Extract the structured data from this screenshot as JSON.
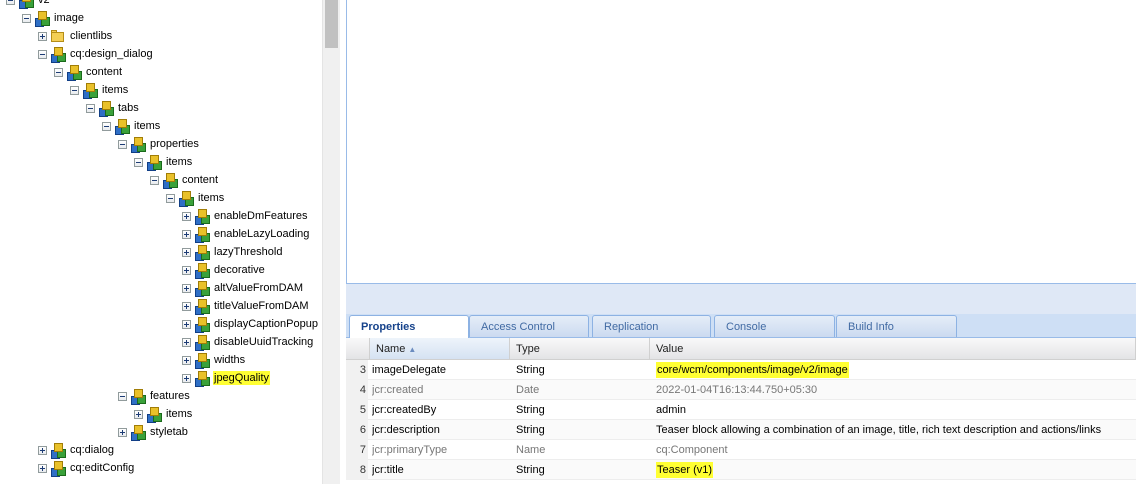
{
  "tree": {
    "nodes": [
      {
        "label": "v2",
        "toggle": "minus",
        "icon": "node",
        "indent": 0,
        "highlight": false
      },
      {
        "label": "image",
        "toggle": "minus",
        "icon": "node",
        "indent": 1,
        "highlight": false
      },
      {
        "label": "clientlibs",
        "toggle": "plus",
        "icon": "folder",
        "indent": 2,
        "highlight": false
      },
      {
        "label": "cq:design_dialog",
        "toggle": "minus",
        "icon": "node",
        "indent": 2,
        "highlight": false
      },
      {
        "label": "content",
        "toggle": "minus",
        "icon": "node",
        "indent": 3,
        "highlight": false
      },
      {
        "label": "items",
        "toggle": "minus",
        "icon": "node",
        "indent": 4,
        "highlight": false
      },
      {
        "label": "tabs",
        "toggle": "minus",
        "icon": "node",
        "indent": 5,
        "highlight": false
      },
      {
        "label": "items",
        "toggle": "minus",
        "icon": "node",
        "indent": 6,
        "highlight": false
      },
      {
        "label": "properties",
        "toggle": "minus",
        "icon": "node",
        "indent": 7,
        "highlight": false
      },
      {
        "label": "items",
        "toggle": "minus",
        "icon": "node",
        "indent": 8,
        "highlight": false
      },
      {
        "label": "content",
        "toggle": "minus",
        "icon": "node",
        "indent": 9,
        "highlight": false
      },
      {
        "label": "items",
        "toggle": "minus",
        "icon": "node",
        "indent": 10,
        "highlight": false
      },
      {
        "label": "enableDmFeatures",
        "toggle": "plus",
        "icon": "node",
        "indent": 11,
        "highlight": false
      },
      {
        "label": "enableLazyLoading",
        "toggle": "plus",
        "icon": "node",
        "indent": 11,
        "highlight": false
      },
      {
        "label": "lazyThreshold",
        "toggle": "plus",
        "icon": "node",
        "indent": 11,
        "highlight": false
      },
      {
        "label": "decorative",
        "toggle": "plus",
        "icon": "node",
        "indent": 11,
        "highlight": false
      },
      {
        "label": "altValueFromDAM",
        "toggle": "plus",
        "icon": "node",
        "indent": 11,
        "highlight": false
      },
      {
        "label": "titleValueFromDAM",
        "toggle": "plus",
        "icon": "node",
        "indent": 11,
        "highlight": false
      },
      {
        "label": "displayCaptionPopup",
        "toggle": "plus",
        "icon": "node",
        "indent": 11,
        "highlight": false
      },
      {
        "label": "disableUuidTracking",
        "toggle": "plus",
        "icon": "node",
        "indent": 11,
        "highlight": false
      },
      {
        "label": "widths",
        "toggle": "plus",
        "icon": "node",
        "indent": 11,
        "highlight": false
      },
      {
        "label": "jpegQuality",
        "toggle": "plus",
        "icon": "node",
        "indent": 11,
        "highlight": true
      },
      {
        "label": "features",
        "toggle": "minus",
        "icon": "node",
        "indent": 7,
        "highlight": false
      },
      {
        "label": "items",
        "toggle": "plus",
        "icon": "node",
        "indent": 8,
        "highlight": false
      },
      {
        "label": "styletab",
        "toggle": "plus",
        "icon": "node",
        "indent": 7,
        "highlight": false
      },
      {
        "label": "cq:dialog",
        "toggle": "plus",
        "icon": "node",
        "indent": 2,
        "highlight": false
      },
      {
        "label": "cq:editConfig",
        "toggle": "plus",
        "icon": "node",
        "indent": 2,
        "highlight": false
      }
    ]
  },
  "tabs": [
    {
      "label": "Properties",
      "active": true
    },
    {
      "label": "Access Control",
      "active": false
    },
    {
      "label": "Replication",
      "active": false
    },
    {
      "label": "Console",
      "active": false
    },
    {
      "label": "Build Info",
      "active": false
    }
  ],
  "grid": {
    "columns": {
      "name": "Name",
      "type": "Type",
      "value": "Value"
    },
    "sort_icon": "sort-ascending-icon",
    "rows": [
      {
        "num": "3",
        "name": "imageDelegate",
        "type": "String",
        "value": "core/wcm/components/image/v2/image",
        "protected": false,
        "highlight": true
      },
      {
        "num": "4",
        "name": "jcr:created",
        "type": "Date",
        "value": "2022-01-04T16:13:44.750+05:30",
        "protected": true,
        "highlight": false
      },
      {
        "num": "5",
        "name": "jcr:createdBy",
        "type": "String",
        "value": "admin",
        "protected": false,
        "highlight": false
      },
      {
        "num": "6",
        "name": "jcr:description",
        "type": "String",
        "value": "Teaser block allowing a combination of an image, title, rich text description and actions/links",
        "protected": false,
        "highlight": false
      },
      {
        "num": "7",
        "name": "jcr:primaryType",
        "type": "Name",
        "value": "cq:Component",
        "protected": true,
        "highlight": false
      },
      {
        "num": "8",
        "name": "jcr:title",
        "type": "String",
        "value": "Teaser (v1)",
        "protected": false,
        "highlight": true
      }
    ]
  },
  "colors": {
    "highlight": "#ffff33",
    "tab_text": "#416aa3",
    "active_tab_text": "#15428b",
    "panel_border": "#99bbe8"
  }
}
